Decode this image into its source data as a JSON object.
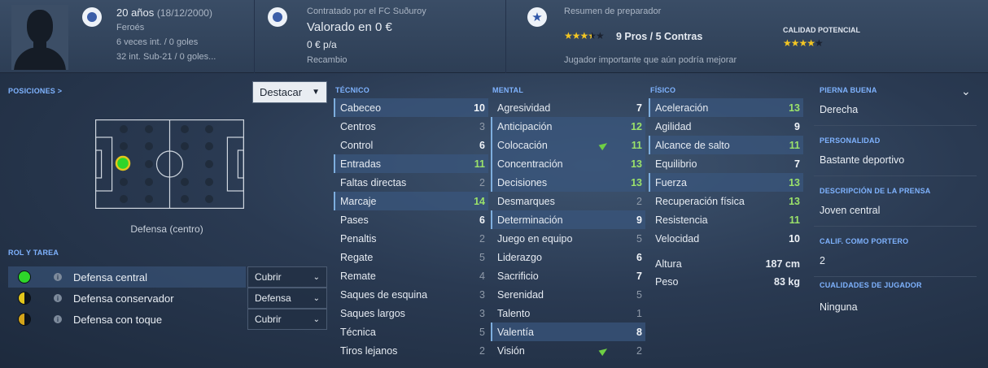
{
  "header": {
    "age": "20 años",
    "dob": "(18/12/2000)",
    "nationality": "Feroés",
    "int_caps": "6 veces int. / 0 goles",
    "u21_caps": "32 int. Sub-21 / 0 goles...",
    "contract_by": "Contratado por el FC Suðuroy",
    "value": "Valorado en 0 €",
    "wage": "0 € p/a",
    "squad_status": "Recambio",
    "coach_summary_label": "Resumen de preparador",
    "pros_cons": "9 Pros / 5 Contras",
    "coach_stars": 3.5,
    "coach_comment": "Jugador importante que aún podría mejorar",
    "potential_label": "CALIDAD POTENCIAL",
    "potential_stars": 4
  },
  "positions": {
    "title": "POSICIONES >",
    "dropdown": "Destacar",
    "position_label": "Defensa (centro)"
  },
  "roles": {
    "title": "ROL Y TAREA",
    "items": [
      {
        "name": "Defensa central",
        "duty": "Cubrir",
        "color": "#2ed52a"
      },
      {
        "name": "Defensa conservador",
        "duty": "Defensa",
        "color": "#e3c61c"
      },
      {
        "name": "Defensa con toque",
        "duty": "Cubrir",
        "color": "#d4a51b"
      }
    ]
  },
  "technical": {
    "title": "TÉCNICO",
    "items": [
      {
        "name": "Cabeceo",
        "value": "10",
        "hl": true
      },
      {
        "name": "Centros",
        "value": "3"
      },
      {
        "name": "Control",
        "value": "6"
      },
      {
        "name": "Entradas",
        "value": "11",
        "hl": true
      },
      {
        "name": "Faltas directas",
        "value": "2"
      },
      {
        "name": "Marcaje",
        "value": "14",
        "hl": true
      },
      {
        "name": "Pases",
        "value": "6"
      },
      {
        "name": "Penaltis",
        "value": "2"
      },
      {
        "name": "Regate",
        "value": "5"
      },
      {
        "name": "Remate",
        "value": "4"
      },
      {
        "name": "Saques de esquina",
        "value": "3"
      },
      {
        "name": "Saques largos",
        "value": "3"
      },
      {
        "name": "Técnica",
        "value": "5"
      },
      {
        "name": "Tiros lejanos",
        "value": "2"
      }
    ]
  },
  "mental": {
    "title": "MENTAL",
    "items": [
      {
        "name": "Agresividad",
        "value": "7"
      },
      {
        "name": "Anticipación",
        "value": "12",
        "hl": true
      },
      {
        "name": "Colocación",
        "value": "11",
        "hl": true,
        "arrow": true
      },
      {
        "name": "Concentración",
        "value": "13",
        "hl": true
      },
      {
        "name": "Decisiones",
        "value": "13",
        "hl": true
      },
      {
        "name": "Desmarques",
        "value": "2"
      },
      {
        "name": "Determinación",
        "value": "9",
        "hl": true
      },
      {
        "name": "Juego en equipo",
        "value": "5"
      },
      {
        "name": "Liderazgo",
        "value": "6"
      },
      {
        "name": "Sacrificio",
        "value": "7"
      },
      {
        "name": "Serenidad",
        "value": "5"
      },
      {
        "name": "Talento",
        "value": "1"
      },
      {
        "name": "Valentía",
        "value": "8",
        "hl": true
      },
      {
        "name": "Visión",
        "value": "2",
        "arrow": true
      }
    ]
  },
  "physical": {
    "title": "FÍSICO",
    "items": [
      {
        "name": "Aceleración",
        "value": "13",
        "hl": true
      },
      {
        "name": "Agilidad",
        "value": "9"
      },
      {
        "name": "Alcance de salto",
        "value": "11",
        "hl": true
      },
      {
        "name": "Equilibrio",
        "value": "7"
      },
      {
        "name": "Fuerza",
        "value": "13",
        "hl": true
      },
      {
        "name": "Recuperación física",
        "value": "13"
      },
      {
        "name": "Resistencia",
        "value": "11"
      },
      {
        "name": "Velocidad",
        "value": "10"
      }
    ],
    "height_label": "Altura",
    "height": "187 cm",
    "weight_label": "Peso",
    "weight": "83 kg"
  },
  "info": {
    "foot_label": "PIERNA BUENA",
    "foot": "Derecha",
    "personality_label": "PERSONALIDAD",
    "personality": "Bastante deportivo",
    "press_label": "DESCRIPCIÓN DE LA PRENSA",
    "press": "Joven central",
    "gk_label": "CALIF. COMO PORTERO",
    "gk": "2",
    "traits_label": "CUALIDADES DE JUGADOR",
    "traits": "Ninguna"
  }
}
